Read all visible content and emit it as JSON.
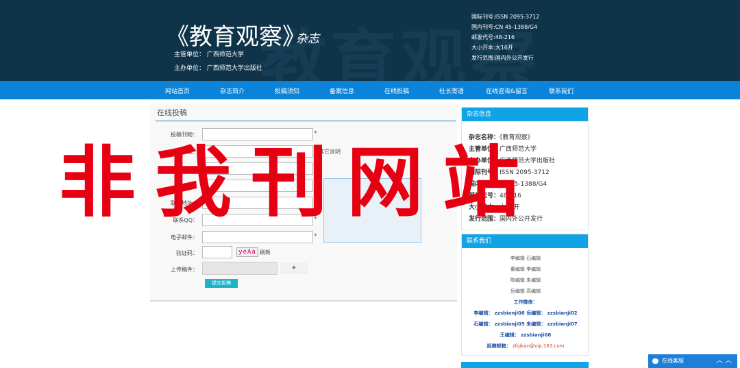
{
  "header": {
    "bg_text": "教育观察",
    "title": "《教育观察》",
    "subtitle": "杂志",
    "org1": "主管单位：  广西师范大学",
    "org2": "主办单位：  广西师范大学出版社",
    "info": [
      "国际刊号:ISSN 2095-3712",
      "国内刊号:CN 45-1388/G4",
      "邮发代号:48-216",
      "大小开本:大16开",
      "发行范围:国内外公开发行"
    ]
  },
  "nav": [
    "网站首页",
    "杂志简介",
    "投稿须知",
    "备案信息",
    "在线投稿",
    "社长寄语",
    "在线咨询&留言",
    "联系我们"
  ],
  "form": {
    "heading": "在线投稿",
    "labels": [
      "投稿刊物：",
      "题：",
      "",
      "名：",
      "联系地址：",
      "联系QQ：",
      "电子邮件："
    ],
    "star": "*",
    "other_note": "其它说明",
    "captcha_label": "验证码：",
    "captcha_code": "yeAa",
    "refresh": "刷新",
    "upload_label": "上传稿件：",
    "submit": "提交投稿"
  },
  "side_info": {
    "title": "杂志信息",
    "rows": [
      {
        "k": "杂志名称：",
        "v": "《教育观察》"
      },
      {
        "k": "主管单位：",
        "v": "广西师范大学"
      },
      {
        "k": "主办单位：",
        "v": "广西师范大学出版社"
      },
      {
        "k": "国际刊号：",
        "v": "ISSN 2095-3712"
      },
      {
        "k": "国内刊号：",
        "v": "CN 45-1388/G4"
      },
      {
        "k": "邮发代号：",
        "v": "48-216"
      },
      {
        "k": "大小开本：",
        "v": "大16开"
      },
      {
        "k": "发行范围：",
        "v": "国内外公开发行"
      }
    ]
  },
  "side_contact": {
    "title": "联系我们",
    "editors": [
      "李编辑  石编辑",
      "董编辑  李编辑",
      "陈编辑  朱编辑",
      "岳编辑  高编辑"
    ],
    "wechat_title": "工作微信：",
    "wechat": [
      "李编辑：  zzsbianji06  岳编辑：  zzsbianji02",
      "石编辑：  zzsbianji05  朱编辑：  zzsbianji07",
      "王编辑：  zzsbianji08"
    ],
    "email_label": "投稿邮箱：",
    "email": "zfqikan@vip.163.com"
  },
  "chat": {
    "label": "在线客服",
    "controls": "︿  ︿"
  },
  "watermark": "非我刊网站",
  "colors": {
    "header_bg": "#0f3449",
    "nav_bg": "#0a83d8",
    "side_head": "#10a3e6",
    "watermark": "#e60012"
  }
}
